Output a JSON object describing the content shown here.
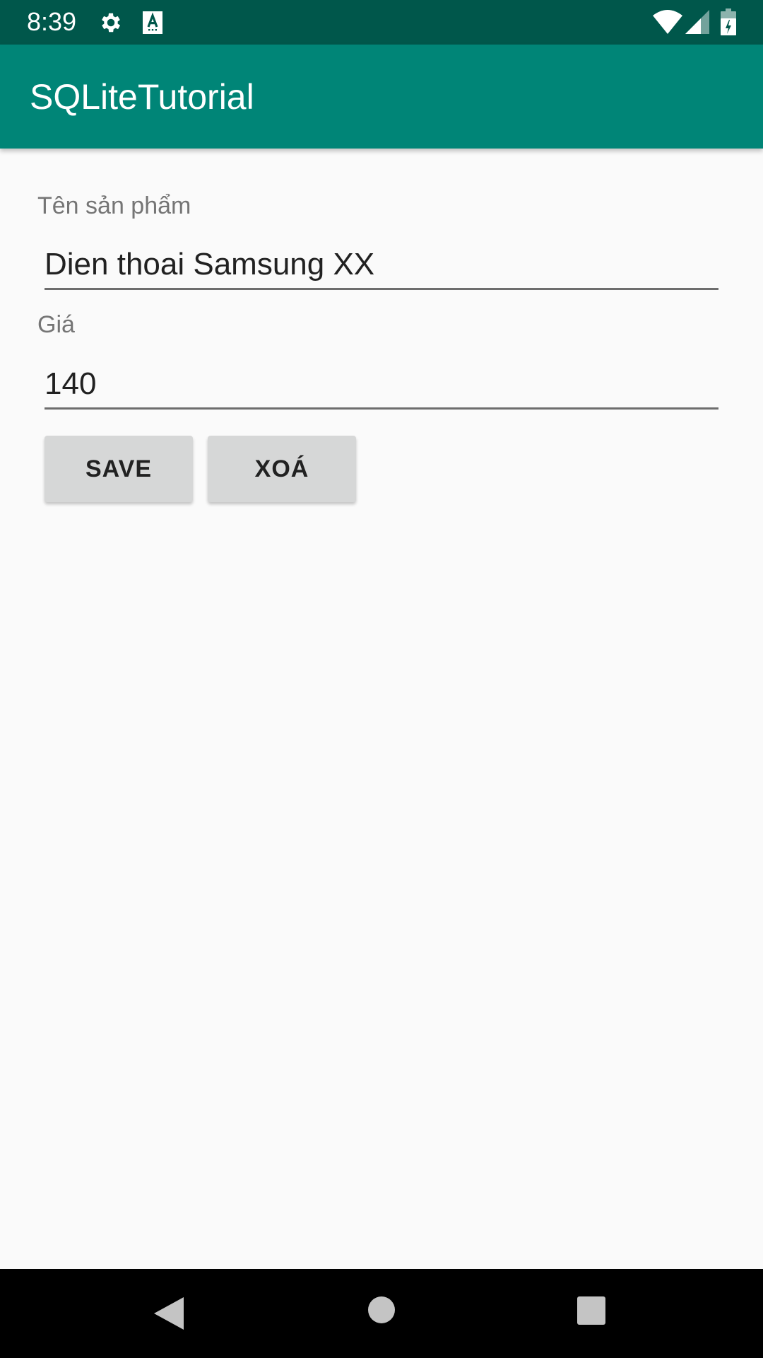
{
  "status_bar": {
    "time": "8:39",
    "icons": [
      "gear-icon",
      "text-a-icon",
      "wifi-icon",
      "cell-signal-icon",
      "battery-icon"
    ],
    "background_color": "#00574b"
  },
  "app_bar": {
    "title": "SQLiteTutorial",
    "background_color": "#008577"
  },
  "form": {
    "name_label": "Tên sản phẩm",
    "name_value": "Dien thoai Samsung XX",
    "price_label": "Giá",
    "price_value": "140"
  },
  "buttons": {
    "save_label": "SAVE",
    "delete_label": "XOÁ"
  },
  "nav_bar": {
    "icons": [
      "back-icon",
      "home-icon",
      "recents-icon"
    ]
  }
}
